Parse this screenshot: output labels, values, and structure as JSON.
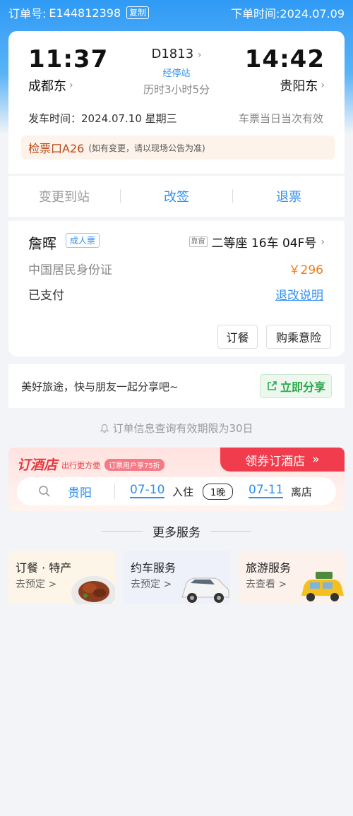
{
  "header": {
    "order_label": "订单号:",
    "order_no": "E144812398",
    "copy_label": "复制",
    "order_time_label": "下单时间:",
    "order_time": "2024.07.09"
  },
  "trip": {
    "depart_time": "11:37",
    "depart_station": "成都东",
    "arrive_time": "14:42",
    "arrive_station": "贵阳东",
    "train_no": "D1813",
    "stops_label": "经停站",
    "duration": "历时3小时5分",
    "depart_date_label": "发车时间：2024.07.10 星期三",
    "validity": "车票当日当次有效",
    "gate": "检票口A26",
    "gate_note": "(如有变更，请以现场公告为准)"
  },
  "actions": {
    "change_station": "变更到站",
    "reschedule": "改签",
    "refund": "退票"
  },
  "passenger": {
    "name": "詹晖",
    "ticket_type": "成人票",
    "window_tag": "靠窗",
    "seat": "二等座 16车 04F号",
    "id_type": "中国居民身份证",
    "price": "￥296",
    "pay_status": "已支付",
    "refund_rules": "退改说明",
    "meal_button": "订餐",
    "insurance_button": "购乘意险"
  },
  "share": {
    "text": "美好旅途，快与朋友一起分享吧~",
    "button": "立即分享"
  },
  "notice": {
    "text": "订单信息查询有效期限为30日"
  },
  "hotel": {
    "brand": "订酒店",
    "slogan": "出行更方便",
    "promo": "订票用户享75折",
    "coupon": "领券订酒店",
    "city": "贵阳",
    "checkin_date": "07-10",
    "checkin_label": "入住",
    "nights": "1晚",
    "checkout_date": "07-11",
    "checkout_label": "离店"
  },
  "more_services": {
    "title": "更多服务",
    "items": [
      {
        "title": "订餐 · 特产",
        "sub": "去预定 >"
      },
      {
        "title": "约车服务",
        "sub": "去预定 >"
      },
      {
        "title": "旅游服务",
        "sub": "去查看 >"
      }
    ]
  },
  "colors": {
    "primary_blue": "#2f8ff0",
    "price_orange": "#f07c1a",
    "hotel_red": "#f03c4c",
    "share_green": "#2aa84a"
  }
}
